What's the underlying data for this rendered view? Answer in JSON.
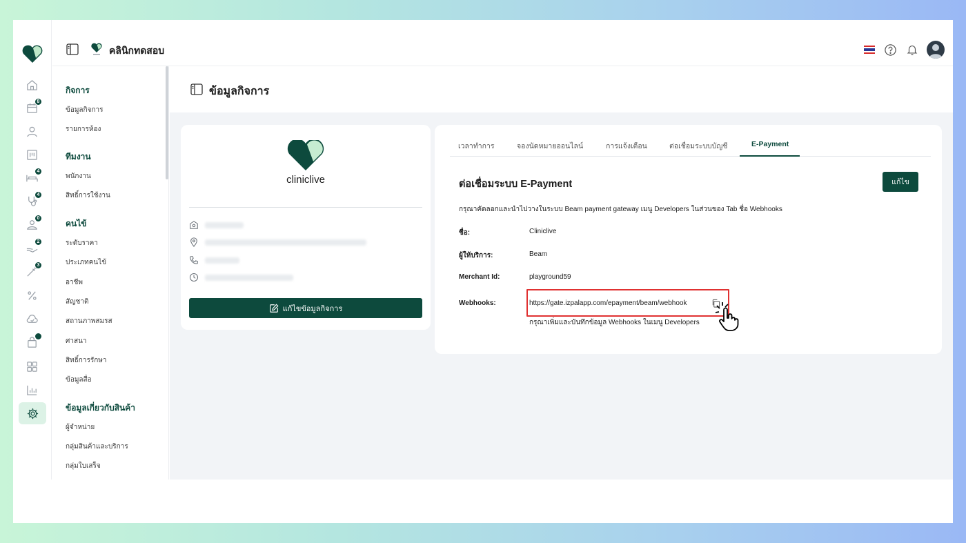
{
  "header": {
    "clinic_name": "คลินิกทดสอบ",
    "icons": [
      "panel-toggle-icon",
      "thai-flag-icon",
      "help-icon",
      "bell-icon",
      "avatar"
    ],
    "colors": {
      "brand": "#0d4a3d",
      "brand_light": "#dcf2e6"
    }
  },
  "rail": {
    "items": [
      {
        "icon": "home-icon"
      },
      {
        "icon": "calendar-icon",
        "badge": "8"
      },
      {
        "icon": "user-icon"
      },
      {
        "icon": "board-icon"
      },
      {
        "icon": "bed-icon",
        "badge": "4"
      },
      {
        "icon": "stethoscope-icon",
        "badge": "4"
      },
      {
        "icon": "patient-icon",
        "badge": "0"
      },
      {
        "icon": "hand-icon",
        "badge": "2"
      },
      {
        "icon": "syringe-icon",
        "badge": "3"
      },
      {
        "icon": "percent-icon"
      },
      {
        "icon": "cloud-icon"
      },
      {
        "icon": "bag-icon",
        "badge": " "
      },
      {
        "icon": "grid-icon"
      },
      {
        "icon": "chart-icon"
      },
      {
        "icon": "gear-icon",
        "active": true
      }
    ]
  },
  "submenu": {
    "sections": [
      {
        "title": "กิจการ",
        "items": [
          "ข้อมูลกิจการ",
          "รายการห้อง"
        ]
      },
      {
        "title": "ทีมงาน",
        "items": [
          "พนักงาน",
          "สิทธิ์การใช้งาน"
        ]
      },
      {
        "title": "คนไข้",
        "items": [
          "ระดับราคา",
          "ประเภทคนไข้",
          "อาชีพ",
          "สัญชาติ",
          "สถานภาพสมรส",
          "ศาสนา",
          "สิทธิ์การรักษา",
          "ข้อมูลสื่อ"
        ]
      },
      {
        "title": "ข้อมูลเกี่ยวกับสินค้า",
        "items": [
          "ผู้จำหน่าย",
          "กลุ่มสินค้าและบริการ",
          "กลุ่มใบเสร็จ"
        ]
      }
    ]
  },
  "page": {
    "title": "ข้อมูลกิจการ"
  },
  "business_card": {
    "brand_name": "cliniclive",
    "edit_button": "แก้ไขข้อมูลกิจการ"
  },
  "tabs": [
    "เวลาทำการ",
    "จองนัดหมายออนไลน์",
    "การแจ้งเตือน",
    "ต่อเชื่อมระบบบัญชี",
    "E-Payment"
  ],
  "epayment": {
    "title": "ต่อเชื่อมระบบ E-Payment",
    "edit_button": "แก้ไข",
    "instruction": "กรุณาคัดลอกและนำไปวางในระบบ Beam payment gateway เมนู Developers ในส่วนของ Tab ชื่อ Webhooks",
    "fields": [
      {
        "label": "ชื่อ:",
        "value": "Cliniclive"
      },
      {
        "label": "ผู้ให้บริการ:",
        "value": "Beam"
      },
      {
        "label": "Merchant Id:",
        "value": "playground59"
      },
      {
        "label": "Webhooks:",
        "value": "https://gate.izpalapp.com/epayment/beam/webhook"
      }
    ],
    "webhook_hint": "กรุณาเพิ่มและบันทึกข้อมูล Webhooks ในเมนู Developers"
  }
}
